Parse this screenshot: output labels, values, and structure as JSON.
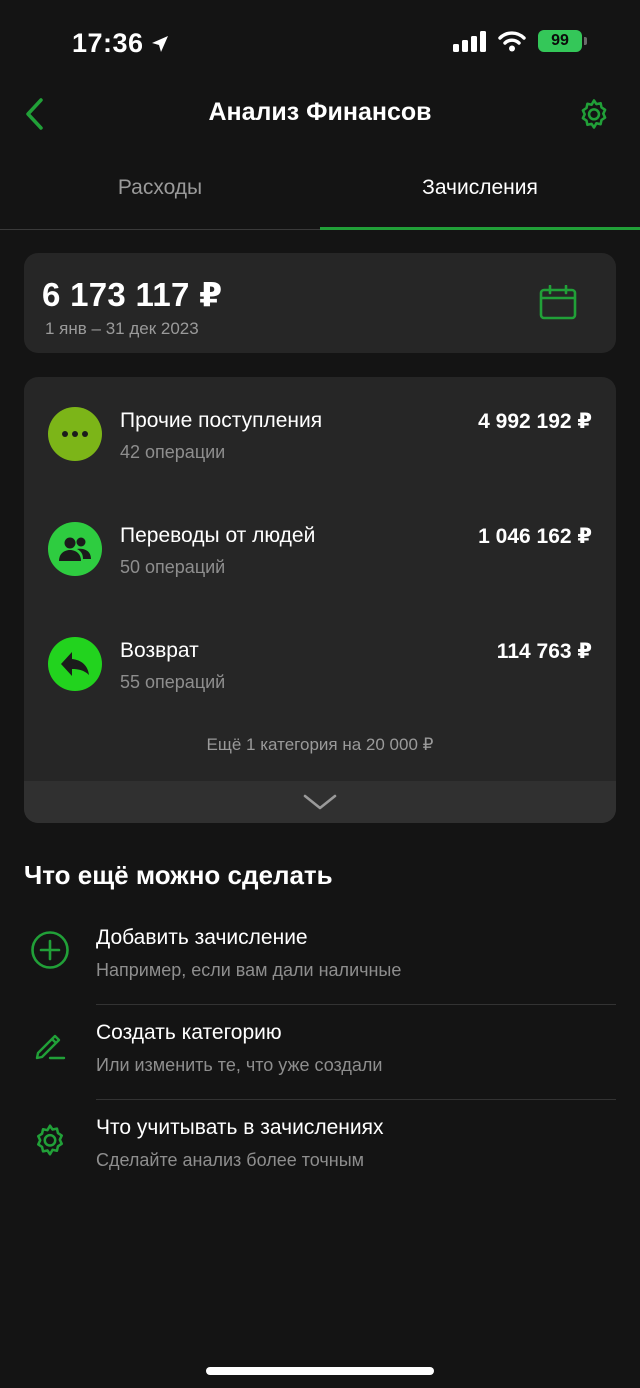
{
  "status": {
    "time": "17:36",
    "battery": "99"
  },
  "header": {
    "title": "Анализ Финансов"
  },
  "tabs": [
    {
      "label": "Расходы",
      "active": false
    },
    {
      "label": "Зачисления",
      "active": true
    }
  ],
  "summary": {
    "total": "6 173 117 ₽",
    "period": "1 янв – 31 дек 2023"
  },
  "categories": [
    {
      "name": "Прочие поступления",
      "ops": "42 операции",
      "amount": "4 992 192 ₽",
      "icon": "more-dots-icon",
      "color": "#7cb518"
    },
    {
      "name": "Переводы от людей",
      "ops": "50 операций",
      "amount": "1 046 162 ₽",
      "icon": "people-icon",
      "color": "#2ecc40"
    },
    {
      "name": "Возврат",
      "ops": "55 операций",
      "amount": "114 763 ₽",
      "icon": "return-arrow-icon",
      "color": "#22d31e"
    }
  ],
  "more_categories": "Ещё 1 категория на 20 000 ₽",
  "actions_section": {
    "title": "Что ещё можно сделать",
    "items": [
      {
        "title": "Добавить зачисление",
        "subtitle": "Например, если вам дали наличные",
        "icon": "plus-circle-icon"
      },
      {
        "title": "Создать категорию",
        "subtitle": "Или изменить те, что уже создали",
        "icon": "pencil-icon"
      },
      {
        "title": "Что учитывать в зачислениях",
        "subtitle": "Сделайте анализ более точным",
        "icon": "gear-icon"
      }
    ]
  },
  "colors": {
    "accent": "#21a038",
    "background": "#141414",
    "card": "#262626"
  }
}
